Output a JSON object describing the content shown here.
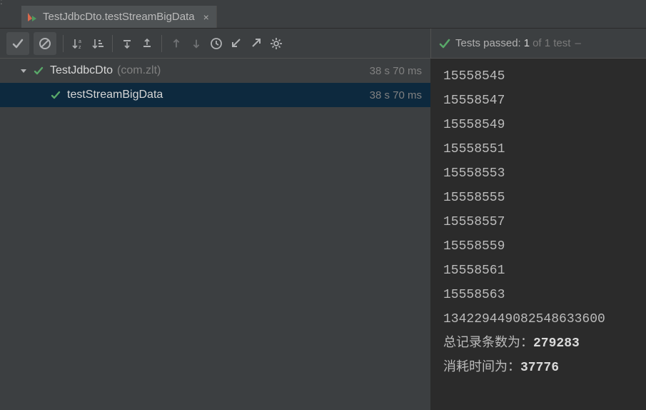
{
  "edge_label": ":",
  "tab": {
    "title": "TestJdbcDto.testStreamBigData",
    "close": "×"
  },
  "toolbar_icons": {
    "show_passed": "check",
    "show_ignored": "ban",
    "sort_alpha": "sort_alpha",
    "sort_dur": "sort_dur",
    "expand": "expand",
    "collapse": "collapse",
    "up": "↑",
    "down": "↓",
    "history": "history",
    "import": "import",
    "export": "export",
    "settings": "gear"
  },
  "summary": {
    "prefix": "Tests passed:",
    "passed": "1",
    "of": "of 1 test",
    "dash": "–"
  },
  "tree": {
    "root": {
      "name": "TestJdbcDto",
      "pkg": "(com.zlt)",
      "dur": "38 s 70 ms"
    },
    "child": {
      "name": "testStreamBigData",
      "dur": "38 s 70 ms"
    }
  },
  "console": {
    "lines": [
      "15558545",
      "15558547",
      "15558549",
      "15558551",
      "15558553",
      "15558555",
      "15558557",
      "15558559",
      "15558561",
      "15558563",
      "134229449082548633600"
    ],
    "records_label": "总记录条数为：",
    "records_value": "279283",
    "time_label": "消耗时间为：",
    "time_value": "37776"
  }
}
